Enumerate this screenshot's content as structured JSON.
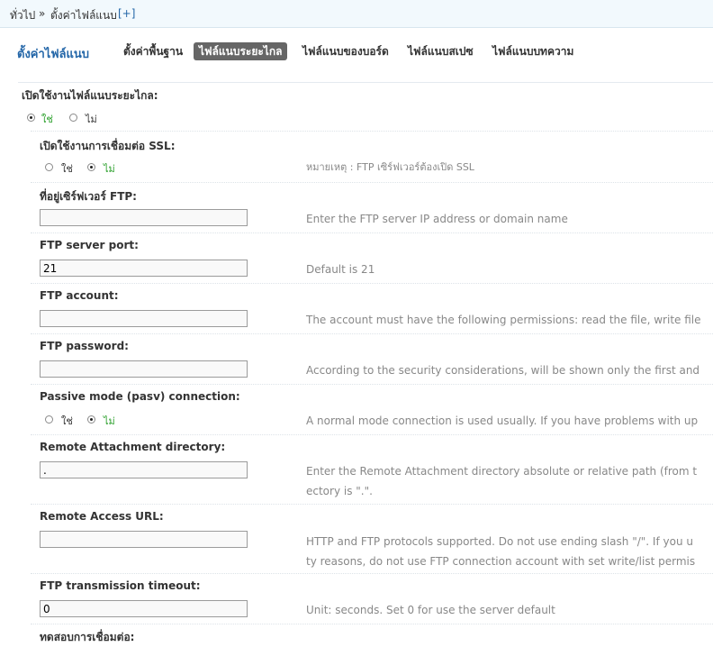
{
  "breadcrumb": {
    "home": "ทั่วไป",
    "separator": "»",
    "current": "ตั้งค่าไฟล์แนบ",
    "add": "[+]"
  },
  "page_title": "ตั้งค่าไฟล์แนบ",
  "tabs": [
    {
      "label": "ตั้งค่าพื้นฐาน",
      "active": false
    },
    {
      "label": "ไฟล์แนบระยะไกล",
      "active": true
    },
    {
      "label": "ไฟล์แนบของบอร์ด",
      "active": false
    },
    {
      "label": "ไฟล์แนบสเปซ",
      "active": false
    },
    {
      "label": "ไฟล์แนบบทความ",
      "active": false
    }
  ],
  "colors": {
    "accent": "#2366a8",
    "selected_option": "#2ca02c",
    "active_tab": "#666666",
    "hint_text": "#888888"
  },
  "fields": {
    "enable_remote": {
      "label": "เปิดใช้งานไฟล์แนบระยะไกล:",
      "yes": "ใช่",
      "no": "ไม่",
      "selected": "yes"
    },
    "ssl": {
      "label": "เปิดใช้งานการเชื่อมต่อ SSL:",
      "yes": "ใช่",
      "no": "ไม่",
      "selected": "no",
      "hint": "หมายเหตุ : FTP เซิร์ฟเวอร์ต้องเปิด SSL"
    },
    "ftp_server": {
      "label": "ที่อยู่เซิร์ฟเวอร์ FTP:",
      "value": "",
      "hint": "Enter the FTP server IP address or domain name"
    },
    "ftp_port": {
      "label": "FTP server port:",
      "value": "21",
      "hint": "Default is 21"
    },
    "ftp_account": {
      "label": "FTP account:",
      "value": "",
      "hint": "The account must have the following permissions: read the file, write file"
    },
    "ftp_password": {
      "label": "FTP password:",
      "value": "",
      "hint": "According to the security considerations, will be shown only the first and"
    },
    "passive": {
      "label": "Passive mode (pasv) connection:",
      "yes": "ใช่",
      "no": "ไม่",
      "selected": "no",
      "hint": "A normal mode connection is used usually. If you have problems with up"
    },
    "remote_dir": {
      "label": "Remote Attachment directory:",
      "value": ".",
      "hint_line1": "Enter the Remote Attachment directory absolute or relative path (from t",
      "hint_line2": "ectory is \".\"."
    },
    "remote_url": {
      "label": "Remote Access URL:",
      "value": "",
      "hint_line1": "HTTP and FTP protocols supported. Do not use ending slash \"/\". If you u",
      "hint_line2": "ty reasons, do not use FTP connection account with set write/list permis"
    },
    "timeout": {
      "label": "FTP transmission timeout:",
      "value": "0",
      "hint": "Unit: seconds. Set 0 for use the server default"
    },
    "test_connection": {
      "label": "ทดสอบการเชื่อมต่อ:"
    }
  }
}
